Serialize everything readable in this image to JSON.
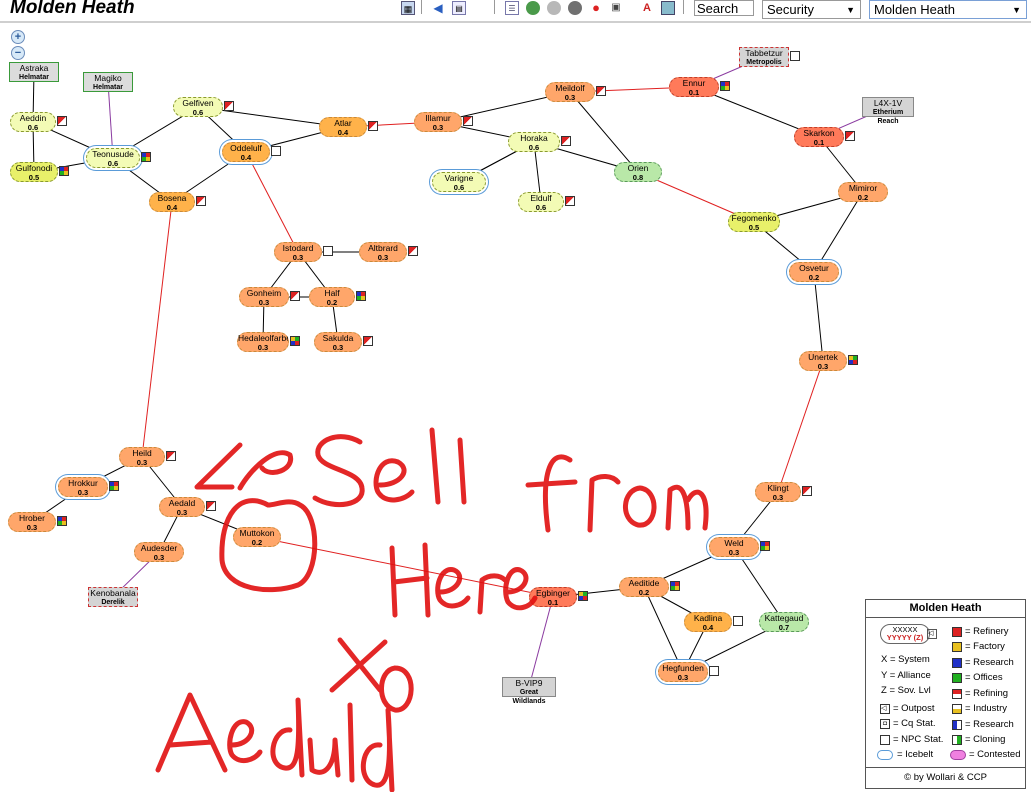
{
  "header": {
    "title": "Molden Heath",
    "search_value": "Search",
    "security_select": "Security",
    "region_select": "Molden Heath"
  },
  "toolbar_icons": [
    "map-icon",
    "back-arrow-icon",
    "calendar-icon",
    "list-icon",
    "globe-icon",
    "sphere-icon",
    "sphere-dark-icon",
    "pin-icon",
    "truck-icon",
    "pdf-icon",
    "image-icon"
  ],
  "systems": [
    {
      "id": "astraka",
      "name": "Astraka",
      "sec": "Helmatar",
      "type": "ext"
    },
    {
      "id": "magiko",
      "name": "Magiko",
      "sec": "Helmatar",
      "type": "ext"
    },
    {
      "id": "aeddin",
      "name": "Aeddin",
      "sec": "0.6"
    },
    {
      "id": "gulfonodi",
      "name": "Gulfonodi",
      "sec": "0.5"
    },
    {
      "id": "teonusude",
      "name": "Teonusude",
      "sec": "0.6"
    },
    {
      "id": "gelfiven",
      "name": "Gelfiven",
      "sec": "0.6"
    },
    {
      "id": "oddelulf",
      "name": "Oddelulf",
      "sec": "0.4"
    },
    {
      "id": "bosena",
      "name": "Bosena",
      "sec": "0.4"
    },
    {
      "id": "atlar",
      "name": "Atlar",
      "sec": "0.4"
    },
    {
      "id": "illamur",
      "name": "Illamur",
      "sec": "0.3"
    },
    {
      "id": "meildolf",
      "name": "Meildolf",
      "sec": "0.3"
    },
    {
      "id": "horaka",
      "name": "Horaka",
      "sec": "0.6"
    },
    {
      "id": "varigne",
      "name": "Varigne",
      "sec": "0.6"
    },
    {
      "id": "eldulf",
      "name": "Eldulf",
      "sec": "0.6"
    },
    {
      "id": "orien",
      "name": "Orien",
      "sec": "0.8"
    },
    {
      "id": "ennur",
      "name": "Ennur",
      "sec": "0.1"
    },
    {
      "id": "tabbetzur",
      "name": "Tabbetzur",
      "sec": "Metropolis",
      "type": "ext"
    },
    {
      "id": "l4x1v",
      "name": "L4X-1V",
      "sec": "Etherium Reach",
      "type": "ext"
    },
    {
      "id": "skarkon",
      "name": "Skarkon",
      "sec": "0.1"
    },
    {
      "id": "mimiror",
      "name": "Mimiror",
      "sec": "0.2"
    },
    {
      "id": "fegomenko",
      "name": "Fegomenko",
      "sec": "0.5"
    },
    {
      "id": "osvetur",
      "name": "Osvetur",
      "sec": "0.2"
    },
    {
      "id": "istodard",
      "name": "Istodard",
      "sec": "0.3"
    },
    {
      "id": "altbrard",
      "name": "Altbrard",
      "sec": "0.3"
    },
    {
      "id": "gonheim",
      "name": "Gonheim",
      "sec": "0.3"
    },
    {
      "id": "half",
      "name": "Half",
      "sec": "0.2"
    },
    {
      "id": "hedaleolfarber",
      "name": "Hedaleolfarber",
      "sec": "0.3"
    },
    {
      "id": "sakulda",
      "name": "Sakulda",
      "sec": "0.3"
    },
    {
      "id": "unertek",
      "name": "Unertek",
      "sec": "0.3"
    },
    {
      "id": "heild",
      "name": "Heild",
      "sec": "0.3"
    },
    {
      "id": "hrokkur",
      "name": "Hrokkur",
      "sec": "0.3"
    },
    {
      "id": "aedald",
      "name": "Aedald",
      "sec": "0.3"
    },
    {
      "id": "hrober",
      "name": "Hrober",
      "sec": "0.3"
    },
    {
      "id": "muttokon",
      "name": "Muttokon",
      "sec": "0.2"
    },
    {
      "id": "audesder",
      "name": "Audesder",
      "sec": "0.3"
    },
    {
      "id": "kenobanala",
      "name": "Kenobanala",
      "sec": "Derelik",
      "type": "ext"
    },
    {
      "id": "klingt",
      "name": "Klingt",
      "sec": "0.3"
    },
    {
      "id": "weld",
      "name": "Weld",
      "sec": "0.3"
    },
    {
      "id": "egbinger",
      "name": "Egbinger",
      "sec": "0.1"
    },
    {
      "id": "aeditide",
      "name": "Aeditide",
      "sec": "0.2"
    },
    {
      "id": "kadlina",
      "name": "Kadlina",
      "sec": "0.4"
    },
    {
      "id": "kattegaud",
      "name": "Kattegaud",
      "sec": "0.7"
    },
    {
      "id": "hegfunden",
      "name": "Hegfunden",
      "sec": "0.3"
    },
    {
      "id": "bvip9",
      "name": "B-VIP9",
      "sec": "Great Wildlands",
      "type": "ext"
    }
  ],
  "annotation": {
    "text": "Sell from Here to Aedald",
    "color": "#e01010"
  },
  "legend": {
    "title": "Molden Heath",
    "sample_name": "XXXXX",
    "sample_sec": "YYYYY (Z)",
    "left_items": [
      "X = System",
      "Y = Alliance",
      "Z = Sov. Lvl",
      "= Outpost",
      "= Cq Stat.",
      "= NPC Stat.",
      "= Icebelt"
    ],
    "right_items": [
      "= Refinery",
      "= Factory",
      "= Research",
      "= Offices",
      "= Refining",
      "= Industry",
      "= Research",
      "= Cloning",
      "= Contested"
    ],
    "footer": "© by Wollari & CCP"
  },
  "colors": {
    "highsec_light": "#f3fbb5",
    "highsec_yellow": "#e8f06a",
    "green": "#b9e8a8",
    "orange": "#ffb24a",
    "orange_light": "#ffa66a",
    "red": "#ff7a5a",
    "jump_black": "#000000",
    "jump_red": "#e02020",
    "jump_purple": "#8a3aa0"
  }
}
